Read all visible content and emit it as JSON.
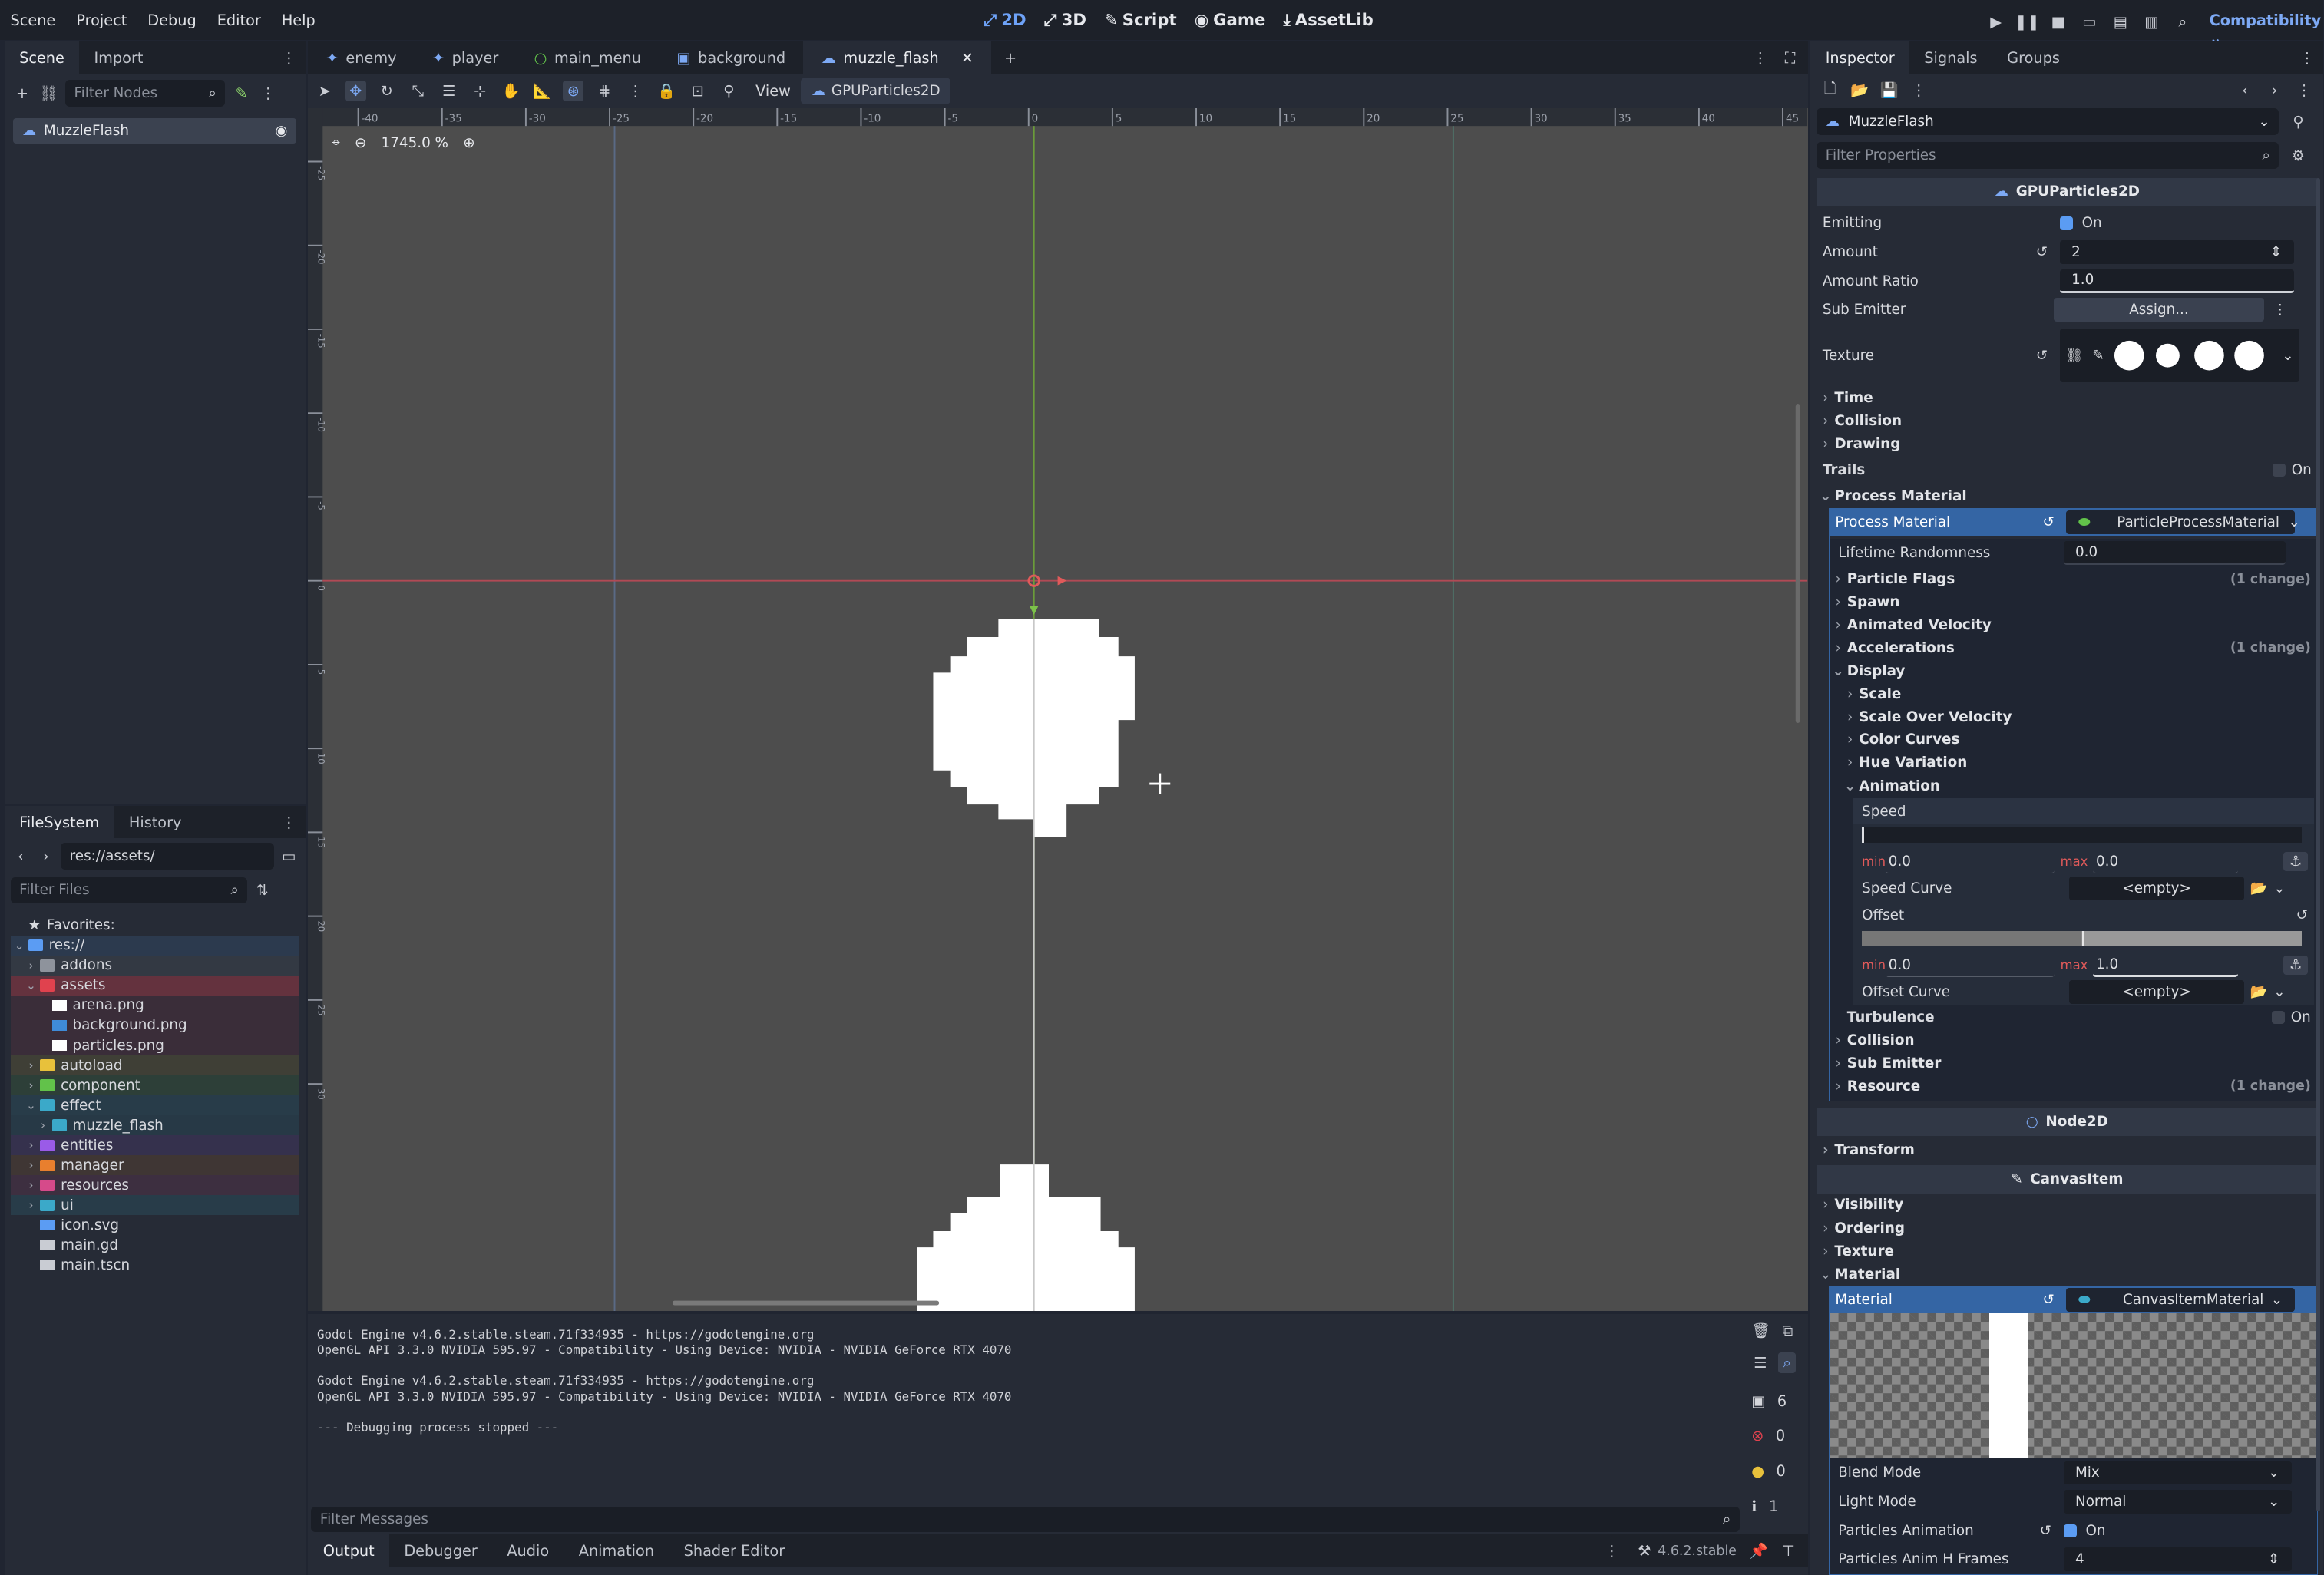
{
  "topbar": {
    "menus": [
      "Scene",
      "Project",
      "Debug",
      "Editor",
      "Help"
    ],
    "workspaces": [
      "2D",
      "3D",
      "Script",
      "Game",
      "AssetLib"
    ],
    "active_workspace": "2D",
    "renderer": "Compatibility"
  },
  "scene_dock": {
    "tabs": [
      "Scene",
      "Import"
    ],
    "filter_placeholder": "Filter Nodes",
    "root_node": "MuzzleFlash"
  },
  "filesystem_dock": {
    "tabs": [
      "FileSystem",
      "History"
    ],
    "path": "res://assets/",
    "filter_placeholder": "Filter Files",
    "favorites_label": "Favorites:",
    "items": [
      {
        "label": "res://",
        "depth": 0,
        "kind": "root",
        "color": "#5b9cf3",
        "fold": "v"
      },
      {
        "label": "addons",
        "depth": 1,
        "kind": "folder",
        "color": "#8e939c",
        "fold": ">"
      },
      {
        "label": "assets",
        "depth": 1,
        "kind": "folder",
        "color": "#e0424e",
        "fold": "v",
        "selected": true
      },
      {
        "label": "arena.png",
        "depth": 2,
        "kind": "file",
        "color": "#ffffff"
      },
      {
        "label": "background.png",
        "depth": 2,
        "kind": "file",
        "color": "#3f8bd8"
      },
      {
        "label": "particles.png",
        "depth": 2,
        "kind": "file",
        "color": "#ffffff"
      },
      {
        "label": "autoload",
        "depth": 1,
        "kind": "folder",
        "color": "#e8c13b",
        "fold": ">"
      },
      {
        "label": "component",
        "depth": 1,
        "kind": "folder",
        "color": "#62c24a",
        "fold": ">"
      },
      {
        "label": "effect",
        "depth": 1,
        "kind": "folder",
        "color": "#3ba9c9",
        "fold": "v"
      },
      {
        "label": "muzzle_flash",
        "depth": 2,
        "kind": "folder",
        "color": "#3ba9c9",
        "fold": ">"
      },
      {
        "label": "entities",
        "depth": 1,
        "kind": "folder",
        "color": "#9a5be8",
        "fold": ">"
      },
      {
        "label": "manager",
        "depth": 1,
        "kind": "folder",
        "color": "#e87f2e",
        "fold": ">"
      },
      {
        "label": "resources",
        "depth": 1,
        "kind": "folder",
        "color": "#d64a8a",
        "fold": ">"
      },
      {
        "label": "ui",
        "depth": 1,
        "kind": "folder",
        "color": "#3ba9c9",
        "fold": ">"
      },
      {
        "label": "icon.svg",
        "depth": 1,
        "kind": "file",
        "color": "#5b9cf3"
      },
      {
        "label": "main.gd",
        "depth": 1,
        "kind": "file",
        "color": "#c9ccd3"
      },
      {
        "label": "main.tscn",
        "depth": 1,
        "kind": "file",
        "color": "#c9ccd3"
      }
    ]
  },
  "editor_tabs": [
    "enemy",
    "player",
    "main_menu",
    "background",
    "muzzle_flash"
  ],
  "active_editor_tab": "muzzle_flash",
  "toolbar": {
    "view_label": "View",
    "node_label": "GPUParticles2D"
  },
  "viewport": {
    "zoom": "1745.0 %",
    "ruler_top": [
      "-40",
      "-35",
      "-30",
      "-25",
      "-20",
      "-15",
      "-10",
      "-5",
      "0",
      "5",
      "10",
      "15",
      "20",
      "25",
      "30",
      "35",
      "40",
      "45"
    ],
    "ruler_left": [
      "-25",
      "-20",
      "-15",
      "-10",
      "-5",
      "0",
      "5",
      "10",
      "15",
      "20",
      "25",
      "30"
    ]
  },
  "output": {
    "lines": [
      "Godot Engine v4.6.2.stable.steam.71f334935 - https://godotengine.org",
      "OpenGL API 3.3.0 NVIDIA 595.97 - Compatibility - Using Device: NVIDIA - NVIDIA GeForce RTX 4070",
      "",
      "Godot Engine v4.6.2.stable.steam.71f334935 - https://godotengine.org",
      "OpenGL API 3.3.0 NVIDIA 595.97 - Compatibility - Using Device: NVIDIA - NVIDIA GeForce RTX 4070",
      "",
      "--- Debugging process stopped ---"
    ],
    "filter_placeholder": "Filter Messages",
    "counts": {
      "messages": "6",
      "errors": "0",
      "warnings": "0",
      "info": "1"
    }
  },
  "bottom_tabs": [
    "Output",
    "Debugger",
    "Audio",
    "Animation",
    "Shader Editor"
  ],
  "version": "4.6.2.stable",
  "inspector": {
    "tabs": [
      "Inspector",
      "Signals",
      "Groups"
    ],
    "object_name": "MuzzleFlash",
    "filter_placeholder": "Filter Properties",
    "class_header": "GPUParticles2D",
    "emitting_label": "Emitting",
    "emitting_value": "On",
    "amount_label": "Amount",
    "amount_value": "2",
    "amount_ratio_label": "Amount Ratio",
    "amount_ratio_value": "1.0",
    "sub_emitter_label": "Sub Emitter",
    "assign_label": "Assign...",
    "texture_label": "Texture",
    "sections_top": [
      "Time",
      "Collision",
      "Drawing"
    ],
    "trails_label": "Trails",
    "trails_value": "On",
    "process_material_section": "Process Material",
    "process_material_label": "Process Material",
    "process_material_value": "ParticleProcessMaterial",
    "lifetime_randomness_label": "Lifetime Randomness",
    "lifetime_randomness_value": "0.0",
    "sub_sections": [
      {
        "label": "Particle Flags",
        "note": "(1 change)"
      },
      {
        "label": "Spawn",
        "note": ""
      },
      {
        "label": "Animated Velocity",
        "note": ""
      },
      {
        "label": "Accelerations",
        "note": "(1 change)"
      }
    ],
    "display_label": "Display",
    "display_sub": [
      "Scale",
      "Scale Over Velocity",
      "Color Curves",
      "Hue Variation"
    ],
    "animation_label": "Animation",
    "speed_label": "Speed",
    "min_label": "min",
    "max_label": "max",
    "speed_min": "0.0",
    "speed_max": "0.0",
    "speed_curve_label": "Speed Curve",
    "empty_label": "<empty>",
    "offset_label": "Offset",
    "offset_min": "0.0",
    "offset_max": "1.0",
    "offset_curve_label": "Offset Curve",
    "turbulence_label": "Turbulence",
    "turbulence_value": "On",
    "more_sections": [
      {
        "label": "Collision",
        "note": ""
      },
      {
        "label": "Sub Emitter",
        "note": ""
      },
      {
        "label": "Resource",
        "note": "(1 change)"
      }
    ],
    "node2d_header": "Node2D",
    "transform_label": "Transform",
    "canvasitem_header": "CanvasItem",
    "canvas_sections": [
      "Visibility",
      "Ordering",
      "Texture",
      "Material"
    ],
    "material_label": "Material",
    "material_value": "CanvasItemMaterial",
    "blend_mode_label": "Blend Mode",
    "blend_mode_value": "Mix",
    "light_mode_label": "Light Mode",
    "light_mode_value": "Normal",
    "particles_anim_label": "Particles Animation",
    "particles_anim_value": "On",
    "anim_h_frames_label": "Particles Anim H Frames",
    "anim_h_frames_value": "4"
  }
}
